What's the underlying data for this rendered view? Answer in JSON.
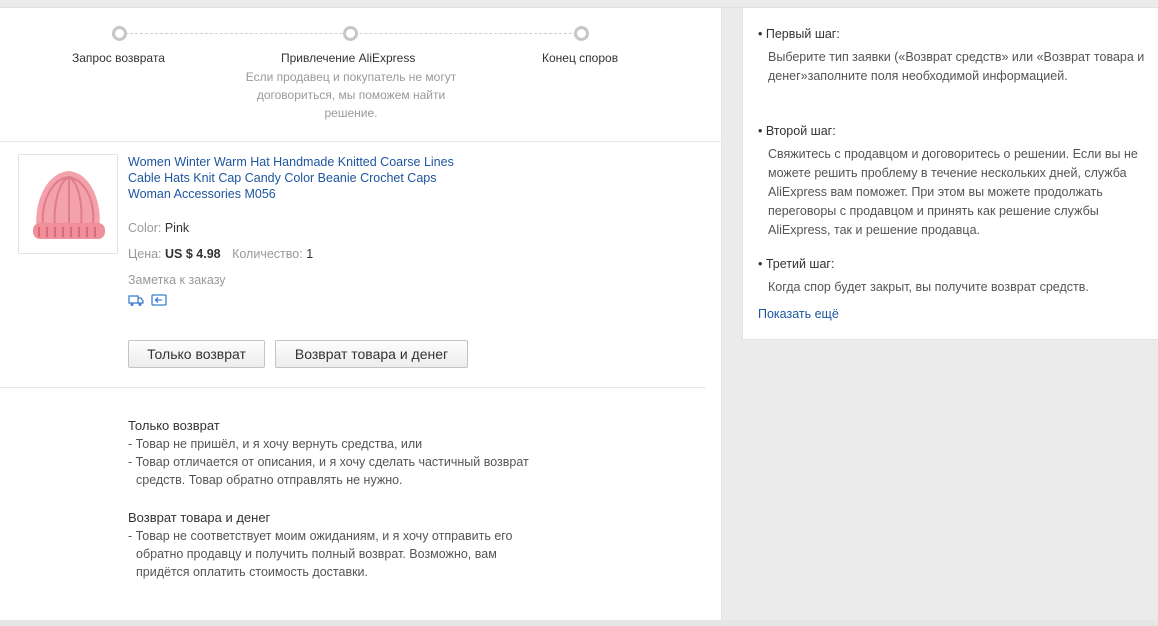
{
  "progress": {
    "steps": [
      {
        "label": "Запрос возврата"
      },
      {
        "label": "Привлечение AliExpress",
        "description": "Если продавец и покупатель не могут договориться, мы поможем найти решение."
      },
      {
        "label": "Конец споров"
      }
    ]
  },
  "product": {
    "title": "Women Winter Warm Hat Handmade Knitted Coarse Lines Cable Hats Knit Cap Candy Color Beanie Crochet Caps Woman Accessories M056",
    "color_label": "Color:",
    "color_value": "Pink",
    "price_label": "Цена:",
    "price_value": "US $ 4.98",
    "qty_label": "Количество:",
    "qty_value": "1",
    "note_label": "Заметка к заказу"
  },
  "buttons": {
    "refund_only": "Только возврат",
    "return_and_refund": "Возврат товара и денег"
  },
  "explanations": {
    "refund_only": {
      "title": "Только возврат",
      "line1": "- Товар не пришёл, и я хочу вернуть средства, или",
      "line2": "- Товар отличается от описания, и я хочу сделать частичный возврат",
      "line3": "средств. Товар обратно отправлять не нужно."
    },
    "return_and_refund": {
      "title": "Возврат товара и денег",
      "line1": "- Товар не соответствует моим ожиданиям, и я хочу отправить его",
      "line2": "обратно продавцу и получить полный возврат. Возможно, вам",
      "line3": "придётся оплатить стоимость доставки."
    }
  },
  "sidebar": {
    "step1_title": "• Первый шаг:",
    "step1_text": "Выберите тип заявки («Возврат средств» или «Возврат товара и денег»заполните поля необходимой информацией.",
    "step2_title": "• Второй шаг:",
    "step2_text": "Свяжитесь с продавцом и договоритесь о решении. Если вы не можете решить проблему в течение нескольких дней, служба AliExpress вам поможет. При этом вы можете продолжать переговоры с продавцом и принять как решение службы AliExpress, так и решение продавца.",
    "step3_title": "• Третий шаг:",
    "step3_text": "Когда спор будет закрыт, вы получите возврат средств.",
    "more_link": "Показать ещё"
  },
  "colors": {
    "link": "#1e56a0",
    "muted": "#999999",
    "hat": "#f08f9a"
  },
  "icons": [
    "shipping-truck-icon",
    "return-arrow-icon"
  ]
}
